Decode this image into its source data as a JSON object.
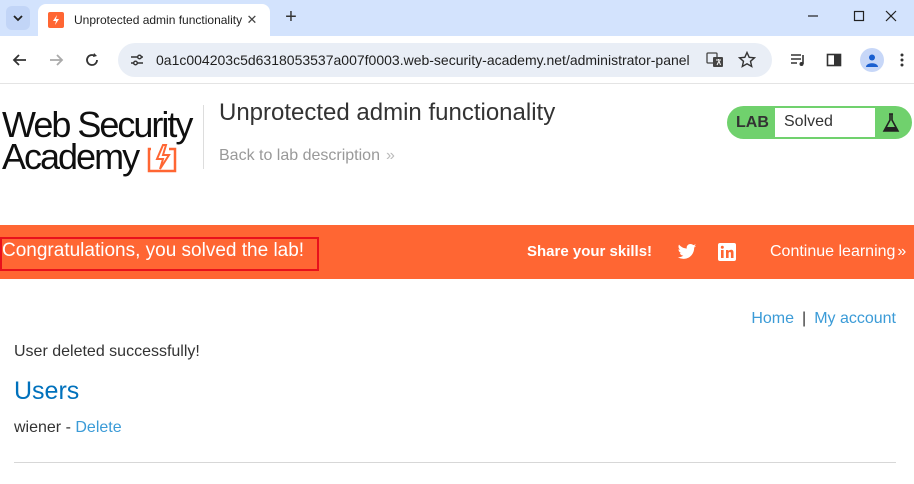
{
  "browser": {
    "tab_title": "Unprotected admin functionality",
    "new_tab_symbol": "+",
    "url": "0a1c004203c5d6318053537a007f0003.web-security-academy.net/administrator-panel"
  },
  "header": {
    "logo_line1": "Web Security",
    "logo_line2": "Academy",
    "lab_title": "Unprotected admin functionality",
    "back_link": "Back to lab description",
    "lab_tag": "LAB",
    "lab_status": "Solved"
  },
  "banner": {
    "congrats": "Congratulations, you solved the lab!",
    "share": "Share your skills!",
    "continue": "Continue learning"
  },
  "nav": {
    "home": "Home",
    "separator": "|",
    "my_account": "My account"
  },
  "main": {
    "message": "User deleted successfully!",
    "heading": "Users",
    "users": [
      {
        "name": "wiener",
        "separator": " - ",
        "action": "Delete"
      }
    ]
  },
  "colors": {
    "brand_orange": "#ff6633",
    "solved_green": "#70d16d",
    "link_blue": "#3b9bd7",
    "heading_blue": "#0071bc"
  }
}
